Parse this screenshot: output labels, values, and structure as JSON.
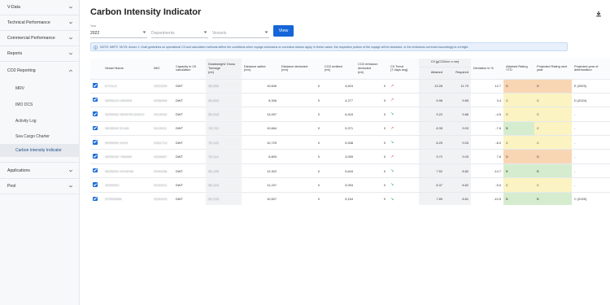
{
  "sidebar": {
    "items": [
      {
        "label": "V-Data",
        "expanded": false
      },
      {
        "label": "Technical Performance",
        "expanded": false
      },
      {
        "label": "Commercial Performance",
        "expanded": false
      },
      {
        "label": "Reports",
        "expanded": false
      },
      {
        "label": "CO2 Reporting",
        "expanded": true
      },
      {
        "label": "Applications",
        "expanded": false
      },
      {
        "label": "Pool",
        "expanded": false
      }
    ],
    "subitems": [
      "MRV",
      "IMO DCS",
      "Activity Log",
      "Sea Cargo Charter",
      "Carbon Intensity Indicator"
    ],
    "active_subitem": "Carbon Intensity Indicator"
  },
  "page": {
    "title": "Carbon Intensity Indicator",
    "download_icon": "download-icon"
  },
  "filters": {
    "year_label": "Year",
    "year_value": "2022",
    "departments_placeholder": "Departments",
    "vessels_placeholder": "Vessels",
    "view_label": "View"
  },
  "note": "NOTE: MEPC 78/7/5, Annex 1. Draft guidelines on operational CII and calculation methods define the conditions when voyage exclusions or correction factors apply. In these cases, the respective portion of the voyage will be deducted, or the emissions corrected accordingly in a freight.",
  "table": {
    "group_header": "CII (gCO2/cm x nm)",
    "headers": {
      "vessel_name": "Vessel Name",
      "imo": "IMO",
      "capacity": "Capacity in CII calculation",
      "deadweight": "Deadweight/ Gross Tonnage",
      "deadweight_unit": "(mt)",
      "distance_sailed": "Distance sailed",
      "distance_sailed_unit": "(nm)",
      "distance_deducted": "Distance deducted",
      "distance_deducted_unit": "(nm)",
      "co2_emitted": "CO2 emitted",
      "co2_emitted_unit": "(mt)",
      "co2_deducted": "CO2 emission deducted",
      "co2_deducted_unit": "(mt)",
      "trend": "CII Trend",
      "trend_unit": "(7 days avg)",
      "attained": "Attained",
      "required": "Required",
      "deviation": "Deviation in %",
      "attained_rating": "Attained Rating YTD",
      "projected_next": "Projected Rating next year",
      "projected_year": "Projected year of deterioration"
    },
    "rows": [
      {
        "name": "ETOILE",
        "imo": "9331525",
        "capacity": "DWT",
        "dwt": "35,059",
        "sailed": "10,606",
        "deducted": "0",
        "co2": "4,624",
        "co2_ded": "0",
        "trend": "up",
        "attained": "13.28",
        "required": "11.79",
        "deviation": "12.7",
        "rating": "D",
        "next": "D",
        "year": "E (2025)"
      },
      {
        "name": "SEREGO ARDEN",
        "imo": "9258406",
        "capacity": "DWT",
        "dwt": "35,603",
        "sailed": "8,306",
        "deducted": "0",
        "co2": "4,277",
        "co2_ded": "0",
        "trend": "up",
        "attained": "9.96",
        "required": "9.65",
        "deviation": "3.4",
        "rating": "C",
        "next": "C",
        "year": "D (2024)"
      },
      {
        "name": "SERENO MONTELENGO",
        "imo": "9415042",
        "capacity": "DWT",
        "dwt": "55,918",
        "sailed": "13,497",
        "deducted": "0",
        "co2": "6,416",
        "co2_ded": "0",
        "trend": "down",
        "attained": "9.22",
        "required": "9.66",
        "deviation": "-4.5",
        "rating": "C",
        "next": "C",
        "year": "-"
      },
      {
        "name": "SERENO ELBA",
        "imo": "9415911",
        "capacity": "DWT",
        "dwt": "78,712",
        "sailed": "10,664",
        "deducted": "0",
        "co2": "5,371",
        "co2_ded": "0",
        "trend": "up",
        "attained": "8.35",
        "required": "9.03",
        "deviation": "-7.6",
        "rating": "B",
        "next": "C",
        "year": "-"
      },
      {
        "name": "SERENO AXIS",
        "imo": "9351713",
        "capacity": "DWT",
        "dwt": "78,116",
        "sailed": "10,729",
        "deducted": "0",
        "co2": "5,538",
        "co2_ded": "0",
        "trend": "down",
        "attained": "8.29",
        "required": "9.03",
        "deviation": "-8.0",
        "rating": "C",
        "next": "C",
        "year": "-"
      },
      {
        "name": "SERENO TAMAR",
        "imo": "9328467",
        "capacity": "DWT",
        "dwt": "78,114",
        "sailed": "6,809",
        "deducted": "0",
        "co2": "3,059",
        "co2_ded": "0",
        "trend": "up",
        "attained": "9.72",
        "required": "9.03",
        "deviation": "7.6",
        "rating": "D",
        "next": "D",
        "year": "-"
      },
      {
        "name": "SERENO ATHENE",
        "imo": "9290268",
        "capacity": "DWT",
        "dwt": "55,105",
        "sailed": "12,302",
        "deducted": "0",
        "co2": "5,644",
        "co2_ded": "0",
        "trend": "down",
        "attained": "7.52",
        "required": "8.82",
        "deviation": "-14.7",
        "rating": "B",
        "next": "B",
        "year": "-"
      },
      {
        "name": "SERENO",
        "imo": "9290412",
        "capacity": "DWT",
        "dwt": "55,103",
        "sailed": "11,247",
        "deducted": "0",
        "co2": "5,053",
        "co2_ded": "0",
        "trend": "down",
        "attained": "8.37",
        "required": "8.82",
        "deviation": "-5.0",
        "rating": "C",
        "next": "C",
        "year": "-"
      },
      {
        "name": "STREMMA",
        "imo": "9290424",
        "capacity": "DWT",
        "dwt": "55,105",
        "sailed": "10,507",
        "deducted": "0",
        "co2": "5,154",
        "co2_ded": "0",
        "trend": "down",
        "attained": "7.89",
        "required": "8.81",
        "deviation": "-10.5",
        "rating": "B",
        "next": "B",
        "year": "C (2025)"
      }
    ]
  },
  "colors": {
    "accent": "#1565d8",
    "rating_A": "#c9e6c4",
    "rating_B": "#d5edce",
    "rating_C": "#fbf3c1",
    "rating_D": "#f8d6b4",
    "rating_E": "#f4c4c4"
  }
}
